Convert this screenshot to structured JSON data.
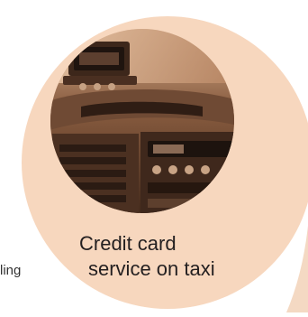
{
  "colors": {
    "peach_circle": "#f7d7be",
    "photo_tone_dark": "#4a2e1f",
    "photo_tone_mid": "#8c6548",
    "photo_tone_light": "#d8b497",
    "caption_text": "#231f20",
    "background": "#ffffff"
  },
  "icons": {
    "photo": "taxi-dashboard-photo",
    "decor": "circle-decor"
  },
  "left_fragment": "ling",
  "caption": {
    "line1": "Credit card",
    "line2": "service on taxi"
  }
}
